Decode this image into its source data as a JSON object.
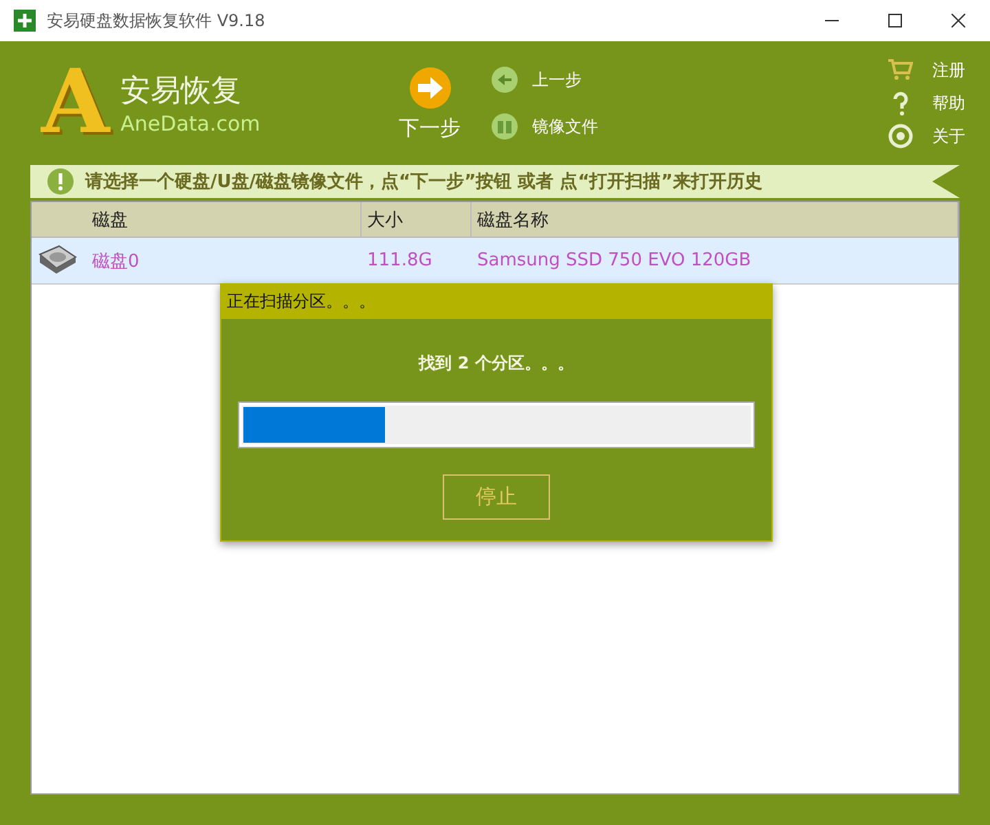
{
  "window": {
    "title": "安易硬盘数据恢复软件 V9.18"
  },
  "logo": {
    "mark": "A",
    "name": "安易恢复",
    "site": "AneData.com"
  },
  "toolbar": {
    "next": "下一步",
    "back": "上一步",
    "image": "镜像文件"
  },
  "side_links": [
    {
      "kind": "cart",
      "label": "注册"
    },
    {
      "kind": "help",
      "label": "帮助"
    },
    {
      "kind": "about",
      "label": "关于"
    }
  ],
  "hint": "请选择一个硬盘/U盘/磁盘镜像文件，点“下一步”按钮 或者 点“打开扫描”来打开历史",
  "table": {
    "columns": [
      "磁盘",
      "大小",
      "磁盘名称"
    ],
    "rows": [
      {
        "disk": "磁盘0",
        "size": "111.8G",
        "name": "Samsung SSD 750 EVO 120GB",
        "selected": true
      }
    ]
  },
  "dialog": {
    "title": "正在扫描分区。。。",
    "message": "找到 2 个分区。。。",
    "level": 0.28,
    "button": "停止"
  }
}
